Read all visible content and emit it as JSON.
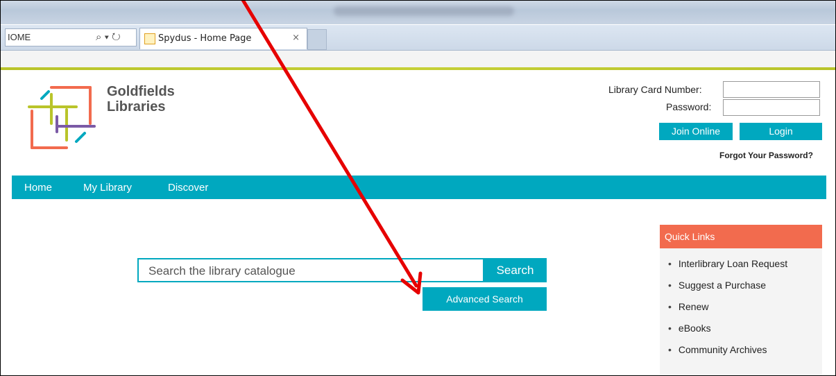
{
  "browser": {
    "address_text": "IOME",
    "tab_title": "Spydus - Home Page",
    "tab_close": "×",
    "search_icon": "search-icon",
    "refresh_icon": "refresh-icon"
  },
  "brand": {
    "line1": "Goldfields",
    "line2": "Libraries"
  },
  "login": {
    "card_label": "Library Card Number:",
    "password_label": "Password:",
    "join_button": "Join Online",
    "login_button": "Login",
    "forgot_link": "Forgot Your Password?"
  },
  "nav": {
    "items": [
      {
        "label": "Home"
      },
      {
        "label": "My Library"
      },
      {
        "label": "Discover"
      }
    ]
  },
  "search": {
    "placeholder": "Search the library catalogue",
    "button": "Search",
    "advanced": "Advanced Search"
  },
  "quick_links": {
    "title": "Quick Links",
    "items": [
      {
        "label": "Interlibrary Loan Request"
      },
      {
        "label": "Suggest a Purchase"
      },
      {
        "label": "Renew"
      },
      {
        "label": "eBooks"
      },
      {
        "label": "Community Archives"
      }
    ]
  },
  "colors": {
    "teal": "#00a8bf",
    "coral": "#f26b4e",
    "olive": "#b9c42a",
    "arrow": "#e60000"
  }
}
